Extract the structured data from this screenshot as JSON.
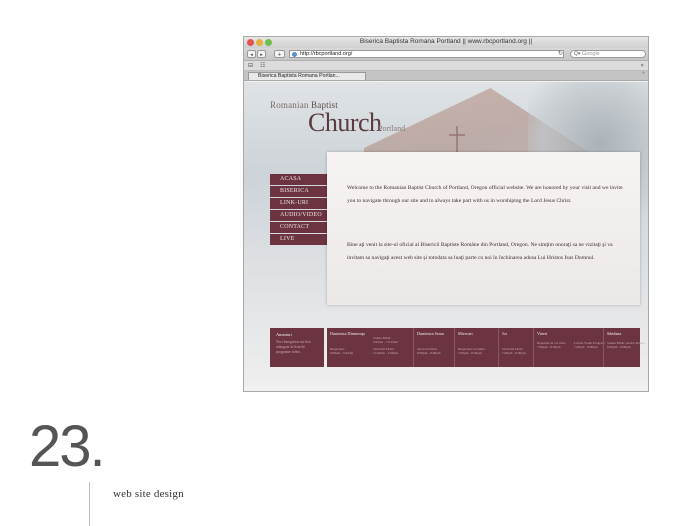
{
  "browser": {
    "window_title": "Biserica Baptista Romana Portland || www.rbcportland.org ||",
    "url": "http://rbcportland.org/",
    "search_placeholder": "Google",
    "tab_title": "Biserica Baptista Romana Portlan...",
    "reload_icon": "reload-icon",
    "back_icon": "back-arrow-icon",
    "forward_icon": "forward-arrow-icon"
  },
  "site": {
    "logo_small_1": "Romanian",
    "logo_small_2": "Baptist",
    "logo_big": "Church",
    "logo_portland": "Portland",
    "menu": [
      "ACASA",
      "BISERICA",
      "LINK-URI",
      "AUDIO/VIDEO",
      "CONTACT",
      "LIVE"
    ],
    "welcome_en": "Welcome to the Romanian Baptist Church of Portland, Oregon official website. We are honored by your visit and we invite you to navigate through our site and to always take part with us in worshiping the Lord Jesus Christ.",
    "welcome_ro": "Bine aţi venit la site-ul oficial al Bisericii Baptiste Române din Portland, Oregon. Ne simţim onoraţi sa ne vizitaţi şi va invitam sa navigaţi acest web site şi totodata sa luaţi parte cu noi în închinarea adusa Lui Hristos Isus Domnul.",
    "announcements_title": "Anunturi",
    "announcements_text": "Nu-i înregistrat nu fost adaugate la lista de programe video.",
    "schedule": [
      {
        "day": "Duminica Dimineaţa",
        "events": [
          {
            "name": "Rugaciune",
            "time": "9:00am - 9:45am"
          }
        ]
      },
      {
        "day": "",
        "events": [
          {
            "name": "Studiu Biblic",
            "time": "9:45am - 10:45am"
          },
          {
            "name": "Serviciul Divin",
            "time": "11:00am - 1:00pm"
          }
        ]
      },
      {
        "day": "Duminica Seara",
        "events": [
          {
            "name": "Serviciu Divin",
            "time": "6:00pm - 8:00pm"
          }
        ]
      },
      {
        "day": "Miercuri",
        "events": [
          {
            "name": "Rugaciune si studiu",
            "time": "7:00pm - 8:30pm"
          }
        ]
      },
      {
        "day": "Joi",
        "events": [
          {
            "name": "Serviciul Divin",
            "time": "7:00pm - 8:30pm"
          }
        ]
      },
      {
        "day": "Vineri",
        "events": [
          {
            "name": "Repetitie de cor mixt",
            "time": "7:00pm - 8:30pm"
          }
        ]
      },
      {
        "day": "",
        "events": [
          {
            "name": "Lucius Youth Program",
            "time": "7:00pm - 9:00pm"
          }
        ]
      },
      {
        "day": "Sâmbata",
        "events": [
          {
            "name": "Studiu Biblic pentru Tineret",
            "time": "6:00pm - 8:00pm"
          }
        ]
      }
    ]
  },
  "caption": {
    "number": "23",
    "dot": ".",
    "label": "web site design"
  },
  "colors": {
    "menu_bg": "#6b3440",
    "logo": "#5a3b40"
  }
}
